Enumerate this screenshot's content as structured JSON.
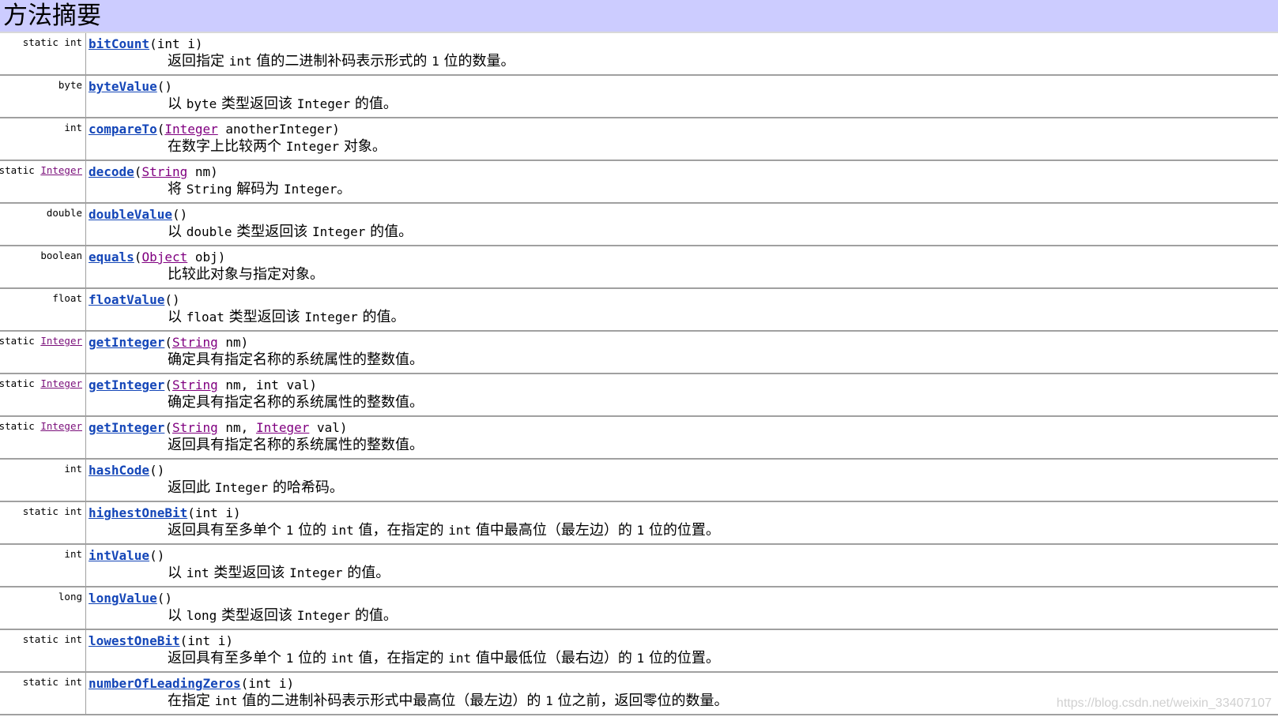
{
  "title": "方法摘要",
  "rows": [
    {
      "modifier": "static int",
      "name": "bitCount",
      "params": "(int i)",
      "desc": "返回指定 int 值的二进制补码表示形式的 1 位的数量。"
    },
    {
      "modifier": "byte",
      "name": "byteValue",
      "params": "()",
      "desc": "以 byte 类型返回该 Integer 的值。"
    },
    {
      "modifier": "int",
      "name": "compareTo",
      "params_parts": [
        "(",
        "Integer",
        " anotherInteger)"
      ],
      "desc": "在数字上比较两个 Integer 对象。"
    },
    {
      "modifier_parts": [
        "static ",
        "Integer"
      ],
      "name": "decode",
      "params_parts": [
        "(",
        "String",
        " nm)"
      ],
      "desc": "将 String 解码为 Integer。"
    },
    {
      "modifier": "double",
      "name": "doubleValue",
      "params": "()",
      "desc": "以 double 类型返回该 Integer 的值。"
    },
    {
      "modifier": "boolean",
      "name": "equals",
      "params_parts": [
        "(",
        "Object",
        " obj)"
      ],
      "desc": "比较此对象与指定对象。"
    },
    {
      "modifier": "float",
      "name": "floatValue",
      "params": "()",
      "desc": "以 float 类型返回该 Integer 的值。"
    },
    {
      "modifier_parts": [
        "static ",
        "Integer"
      ],
      "name": "getInteger",
      "params_parts": [
        "(",
        "String",
        " nm)"
      ],
      "desc": "确定具有指定名称的系统属性的整数值。"
    },
    {
      "modifier_parts": [
        "static ",
        "Integer"
      ],
      "name": "getInteger",
      "params_parts": [
        "(",
        "String",
        " nm, int val)"
      ],
      "desc": "确定具有指定名称的系统属性的整数值。"
    },
    {
      "modifier_parts": [
        "static ",
        "Integer"
      ],
      "name": "getInteger",
      "params_parts": [
        "(",
        "String",
        " nm, ",
        "Integer",
        " val)"
      ],
      "desc": "返回具有指定名称的系统属性的整数值。"
    },
    {
      "modifier": "int",
      "name": "hashCode",
      "params": "()",
      "desc": "返回此 Integer 的哈希码。"
    },
    {
      "modifier": "static int",
      "name": "highestOneBit",
      "params": "(int i)",
      "desc": "返回具有至多单个 1 位的 int 值，在指定的 int 值中最高位（最左边）的 1 位的位置。"
    },
    {
      "modifier": "int",
      "name": "intValue",
      "params": "()",
      "desc": "以 int 类型返回该 Integer 的值。"
    },
    {
      "modifier": "long",
      "name": "longValue",
      "params": "()",
      "desc": "以 long 类型返回该 Integer 的值。"
    },
    {
      "modifier": "static int",
      "name": "lowestOneBit",
      "params": "(int i)",
      "desc": "返回具有至多单个 1 位的 int 值，在指定的 int 值中最低位（最右边）的 1 位的位置。"
    },
    {
      "modifier": "static int",
      "name": "numberOfLeadingZeros",
      "params": "(int i)",
      "desc": "在指定 int 值的二进制补码表示形式中最高位（最左边）的 1 位之前，返回零位的数量。"
    }
  ],
  "watermark": "https://blog.csdn.net/weixin_33407107",
  "colors": {
    "header_bg": "#ccccff",
    "method_link": "#1446b8",
    "type_link": "#800080"
  }
}
